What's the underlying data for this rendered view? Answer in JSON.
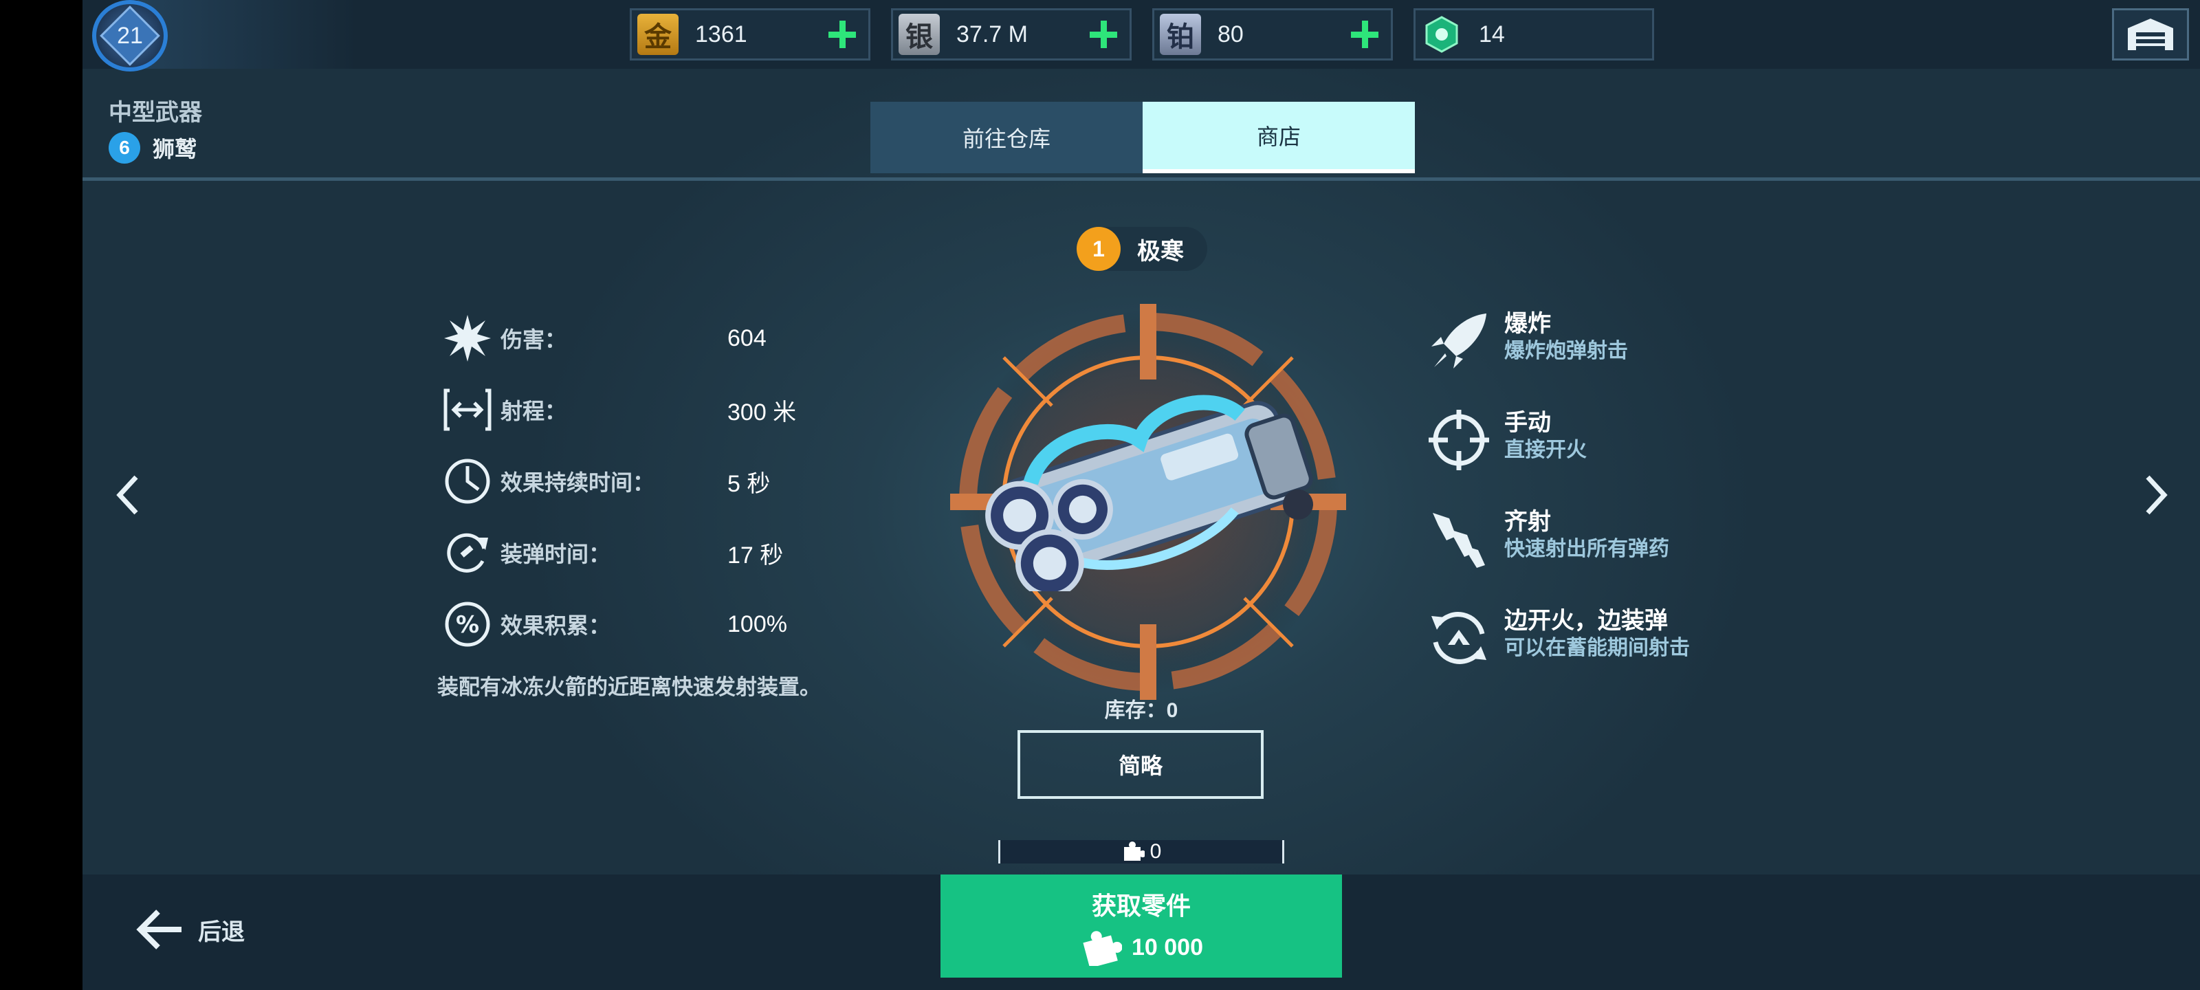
{
  "topbar": {
    "level": "21",
    "currencies": [
      {
        "name": "gold",
        "glyph": "金",
        "value": "1361"
      },
      {
        "name": "silver",
        "glyph": "银",
        "value": "37.7 M"
      },
      {
        "name": "platinum",
        "glyph": "铂",
        "value": "80"
      },
      {
        "name": "gem",
        "value": "14"
      }
    ]
  },
  "header": {
    "category": "中型武器",
    "weapon_level": "6",
    "weapon_name": "狮鹫"
  },
  "tabs": [
    {
      "label": "前往仓库",
      "active": false
    },
    {
      "label": "商店",
      "active": true
    }
  ],
  "stats": [
    {
      "label": "伤害：",
      "value": "604",
      "icon": "explosion-icon"
    },
    {
      "label": "射程：",
      "value": "300 米",
      "icon": "range-icon"
    },
    {
      "label": "效果持续时间：",
      "value": "5 秒",
      "icon": "duration-icon"
    },
    {
      "label": "装弹时间：",
      "value": "17 秒",
      "icon": "reload-icon"
    },
    {
      "label": "效果积累：",
      "value": "100%",
      "icon": "percent-icon"
    }
  ],
  "description": "装配有冰冻火箭的近距离快速发射装置。",
  "rarity": {
    "number": "1",
    "name": "极寒",
    "color": "#f3a01c"
  },
  "stock": "库存：0",
  "summary_button": "简略",
  "parts_count": "0",
  "features": [
    {
      "title": "爆炸",
      "desc": "爆炸炮弹射击",
      "icon": "rocket-icon"
    },
    {
      "title": "手动",
      "desc": "直接开火",
      "icon": "crosshair-icon"
    },
    {
      "title": "齐射",
      "desc": "快速射出所有弹药",
      "icon": "salvo-icon"
    },
    {
      "title": "边开火，边装弹",
      "desc": "可以在蓄能期间射击",
      "icon": "fire-reload-icon"
    }
  ],
  "bottom": {
    "back_label": "后退",
    "get_parts_label": "获取零件",
    "get_parts_price": "10 000"
  },
  "colors": {
    "accent_green": "#16c283",
    "plus_green": "#2ee57a",
    "tab_active": "#c8fbfb"
  }
}
